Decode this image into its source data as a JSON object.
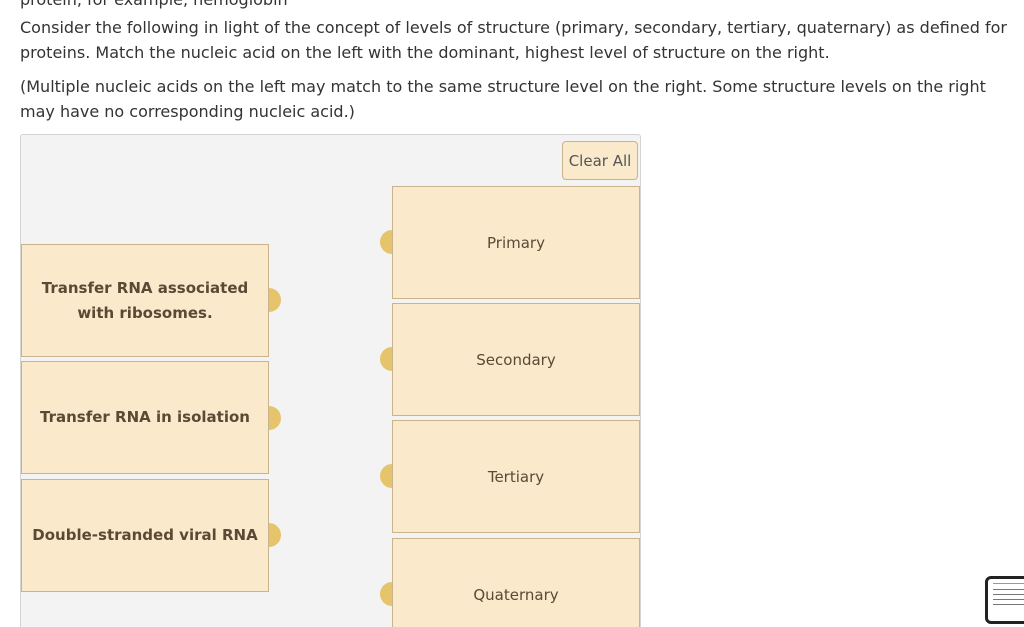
{
  "question": {
    "cut_line": "protein, for example, hemoglobin",
    "instruction": "Consider the following in light of the concept of levels of structure (primary, secondary, tertiary, quaternary) as defined for proteins. Match the nucleic acid on the left with the dominant, highest level of structure on the right.",
    "note": "(Multiple nucleic acids on the left may match to the same structure level on the right. Some structure levels on the right may have no corresponding nucleic acid.)"
  },
  "clear_all_label": "Clear All",
  "left_items": [
    {
      "label": "Transfer RNA associated with ribosomes."
    },
    {
      "label": "Transfer RNA in isolation"
    },
    {
      "label": "Double-stranded viral RNA"
    }
  ],
  "right_items": [
    {
      "label": "Primary"
    },
    {
      "label": "Secondary"
    },
    {
      "label": "Tertiary"
    },
    {
      "label": "Quaternary"
    }
  ],
  "colors": {
    "card_fill": "#fbe9cc",
    "card_border": "#c9b48e",
    "knob": "#e6c46b",
    "panel": "#f3f3f3"
  }
}
